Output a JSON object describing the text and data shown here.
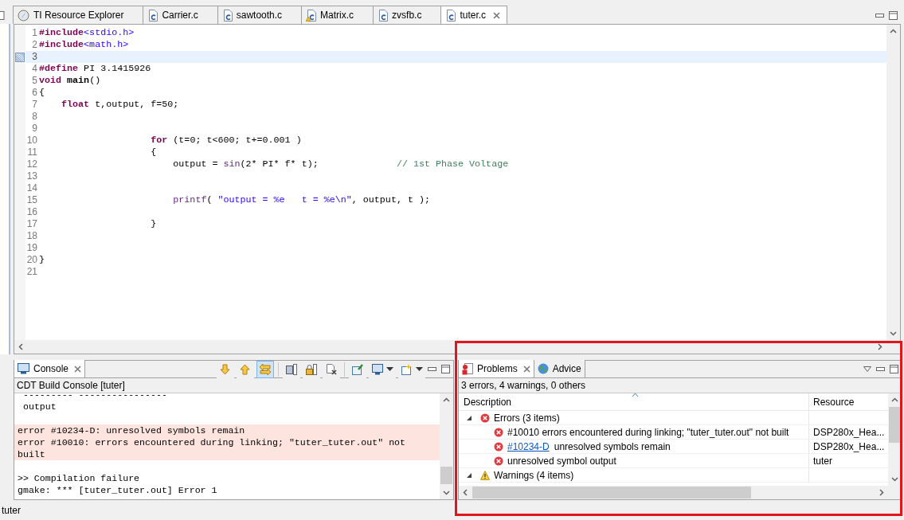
{
  "editor_tabs": [
    {
      "label": "TI Resource Explorer",
      "kind": "explorer",
      "selected": false
    },
    {
      "label": "Carrier.c",
      "kind": "c-file",
      "selected": false
    },
    {
      "label": "sawtooth.c",
      "kind": "c-file",
      "selected": false
    },
    {
      "label": "Matrix.c",
      "kind": "c-file-warning",
      "selected": false
    },
    {
      "label": "zvsfb.c",
      "kind": "c-file",
      "selected": false
    },
    {
      "label": "tuter.c",
      "kind": "c-file",
      "selected": true
    }
  ],
  "editor": {
    "lines": [
      {
        "number": "1",
        "current": false,
        "tokens": [
          {
            "kind": "keyword",
            "text": "#include"
          },
          {
            "kind": "string",
            "text": "<stdio.h>"
          }
        ]
      },
      {
        "number": "2",
        "current": false,
        "tokens": [
          {
            "kind": "keyword",
            "text": "#include"
          },
          {
            "kind": "string",
            "text": "<math.h>"
          }
        ]
      },
      {
        "number": "3",
        "current": true
      },
      {
        "number": "4",
        "current": false,
        "tokens": [
          {
            "kind": "keyword",
            "text": "#define"
          },
          {
            "kind": "plain",
            "text": " PI 3.1415926"
          }
        ]
      },
      {
        "number": "5",
        "current": false,
        "tokens": [
          {
            "kind": "keyword",
            "text": "void "
          },
          {
            "kind": "function",
            "text": "main"
          },
          {
            "kind": "plain",
            "text": "()"
          }
        ]
      },
      {
        "number": "6",
        "current": false,
        "tokens": [
          {
            "kind": "plain",
            "text": "{"
          }
        ]
      },
      {
        "number": "7",
        "current": false,
        "tokens": [
          {
            "kind": "keyword",
            "text": "    float"
          },
          {
            "kind": "plain",
            "text": " t,output, f=50;"
          }
        ]
      },
      {
        "number": "8",
        "current": false
      },
      {
        "number": "9",
        "current": false
      },
      {
        "number": "10",
        "current": false,
        "tokens": [
          {
            "kind": "keyword",
            "text": "                    for"
          },
          {
            "kind": "plain",
            "text": " (t=0; t<600; t+=0.001 )"
          }
        ]
      },
      {
        "number": "11",
        "current": false,
        "tokens": [
          {
            "kind": "plain",
            "text": "                    {"
          }
        ]
      },
      {
        "number": "12",
        "current": false,
        "tokens": [
          {
            "kind": "plain",
            "text": "                        output = "
          },
          {
            "kind": "call",
            "text": "sin"
          },
          {
            "kind": "plain",
            "text": "(2* PI* f* t);"
          },
          {
            "kind": "comment",
            "text": "              // 1st Phase Voltage"
          }
        ]
      },
      {
        "number": "13",
        "current": false
      },
      {
        "number": "14",
        "current": false
      },
      {
        "number": "15",
        "current": false,
        "tokens": [
          {
            "kind": "call",
            "text": "                        printf"
          },
          {
            "kind": "plain",
            "text": "( "
          },
          {
            "kind": "string",
            "text": "\"output = %e   t = %e\\n\""
          },
          {
            "kind": "plain",
            "text": ", output, t );"
          }
        ]
      },
      {
        "number": "16",
        "current": false
      },
      {
        "number": "17",
        "current": false,
        "tokens": [
          {
            "kind": "plain",
            "text": "                    }"
          }
        ]
      },
      {
        "number": "18",
        "current": false
      },
      {
        "number": "19",
        "current": false
      },
      {
        "number": "20",
        "current": false,
        "tokens": [
          {
            "kind": "plain",
            "text": "}"
          }
        ]
      },
      {
        "number": "21",
        "current": false
      }
    ]
  },
  "console": {
    "tab": "Console",
    "toolbar": [
      {
        "kind": "down",
        "selected": false
      },
      {
        "kind": "up",
        "selected": false
      },
      {
        "kind": "swap",
        "selected": true
      },
      {
        "kind": "separator"
      },
      {
        "kind": "save",
        "selected": false
      },
      {
        "kind": "lock",
        "selected": false
      },
      {
        "kind": "clear",
        "selected": false
      },
      {
        "kind": "separator"
      },
      {
        "kind": "pin",
        "selected": false
      },
      {
        "kind": "display",
        "selected": false
      },
      {
        "kind": "new",
        "selected": false
      }
    ],
    "title": "CDT Build Console [tuter]",
    "lines": [
      {
        "kind": "normal",
        "text": " --------- ----------------"
      },
      {
        "kind": "normal",
        "text": " output"
      },
      {
        "kind": "blank"
      },
      {
        "kind": "error",
        "text": "error #10234-D: unresolved symbols remain"
      },
      {
        "kind": "error",
        "text": "error #10010: errors encountered during linking; \"tuter_tuter.out\" not built"
      },
      {
        "kind": "blank"
      },
      {
        "kind": "normal",
        "text": ">> Compilation failure"
      },
      {
        "kind": "normal",
        "text": "gmake: *** [tuter_tuter.out] Error 1"
      }
    ]
  },
  "problems": {
    "tabs": [
      {
        "label": "Problems",
        "kind": "problems",
        "selected": true
      },
      {
        "label": "Advice",
        "kind": "advice",
        "selected": false
      }
    ],
    "summary": "3 errors, 4 warnings, 0 others",
    "columns": [
      "Description",
      "Resource"
    ],
    "rows": [
      {
        "kind": "error-group",
        "expanded": true,
        "description": "Errors (3 items)"
      },
      {
        "kind": "error",
        "description": "#10010 errors encountered during linking; \"tuter_tuter.out\" not built",
        "resource": "DSP280x_Hea..."
      },
      {
        "kind": "error",
        "link": "#10234-D",
        "description": "unresolved symbols remain",
        "resource": "DSP280x_Hea..."
      },
      {
        "kind": "error",
        "description": "unresolved symbol output",
        "resource": "tuter"
      },
      {
        "kind": "warning-group",
        "expanded": true,
        "description": "Warnings (4 items)"
      }
    ]
  },
  "status_bar": {
    "text": "tuter"
  }
}
